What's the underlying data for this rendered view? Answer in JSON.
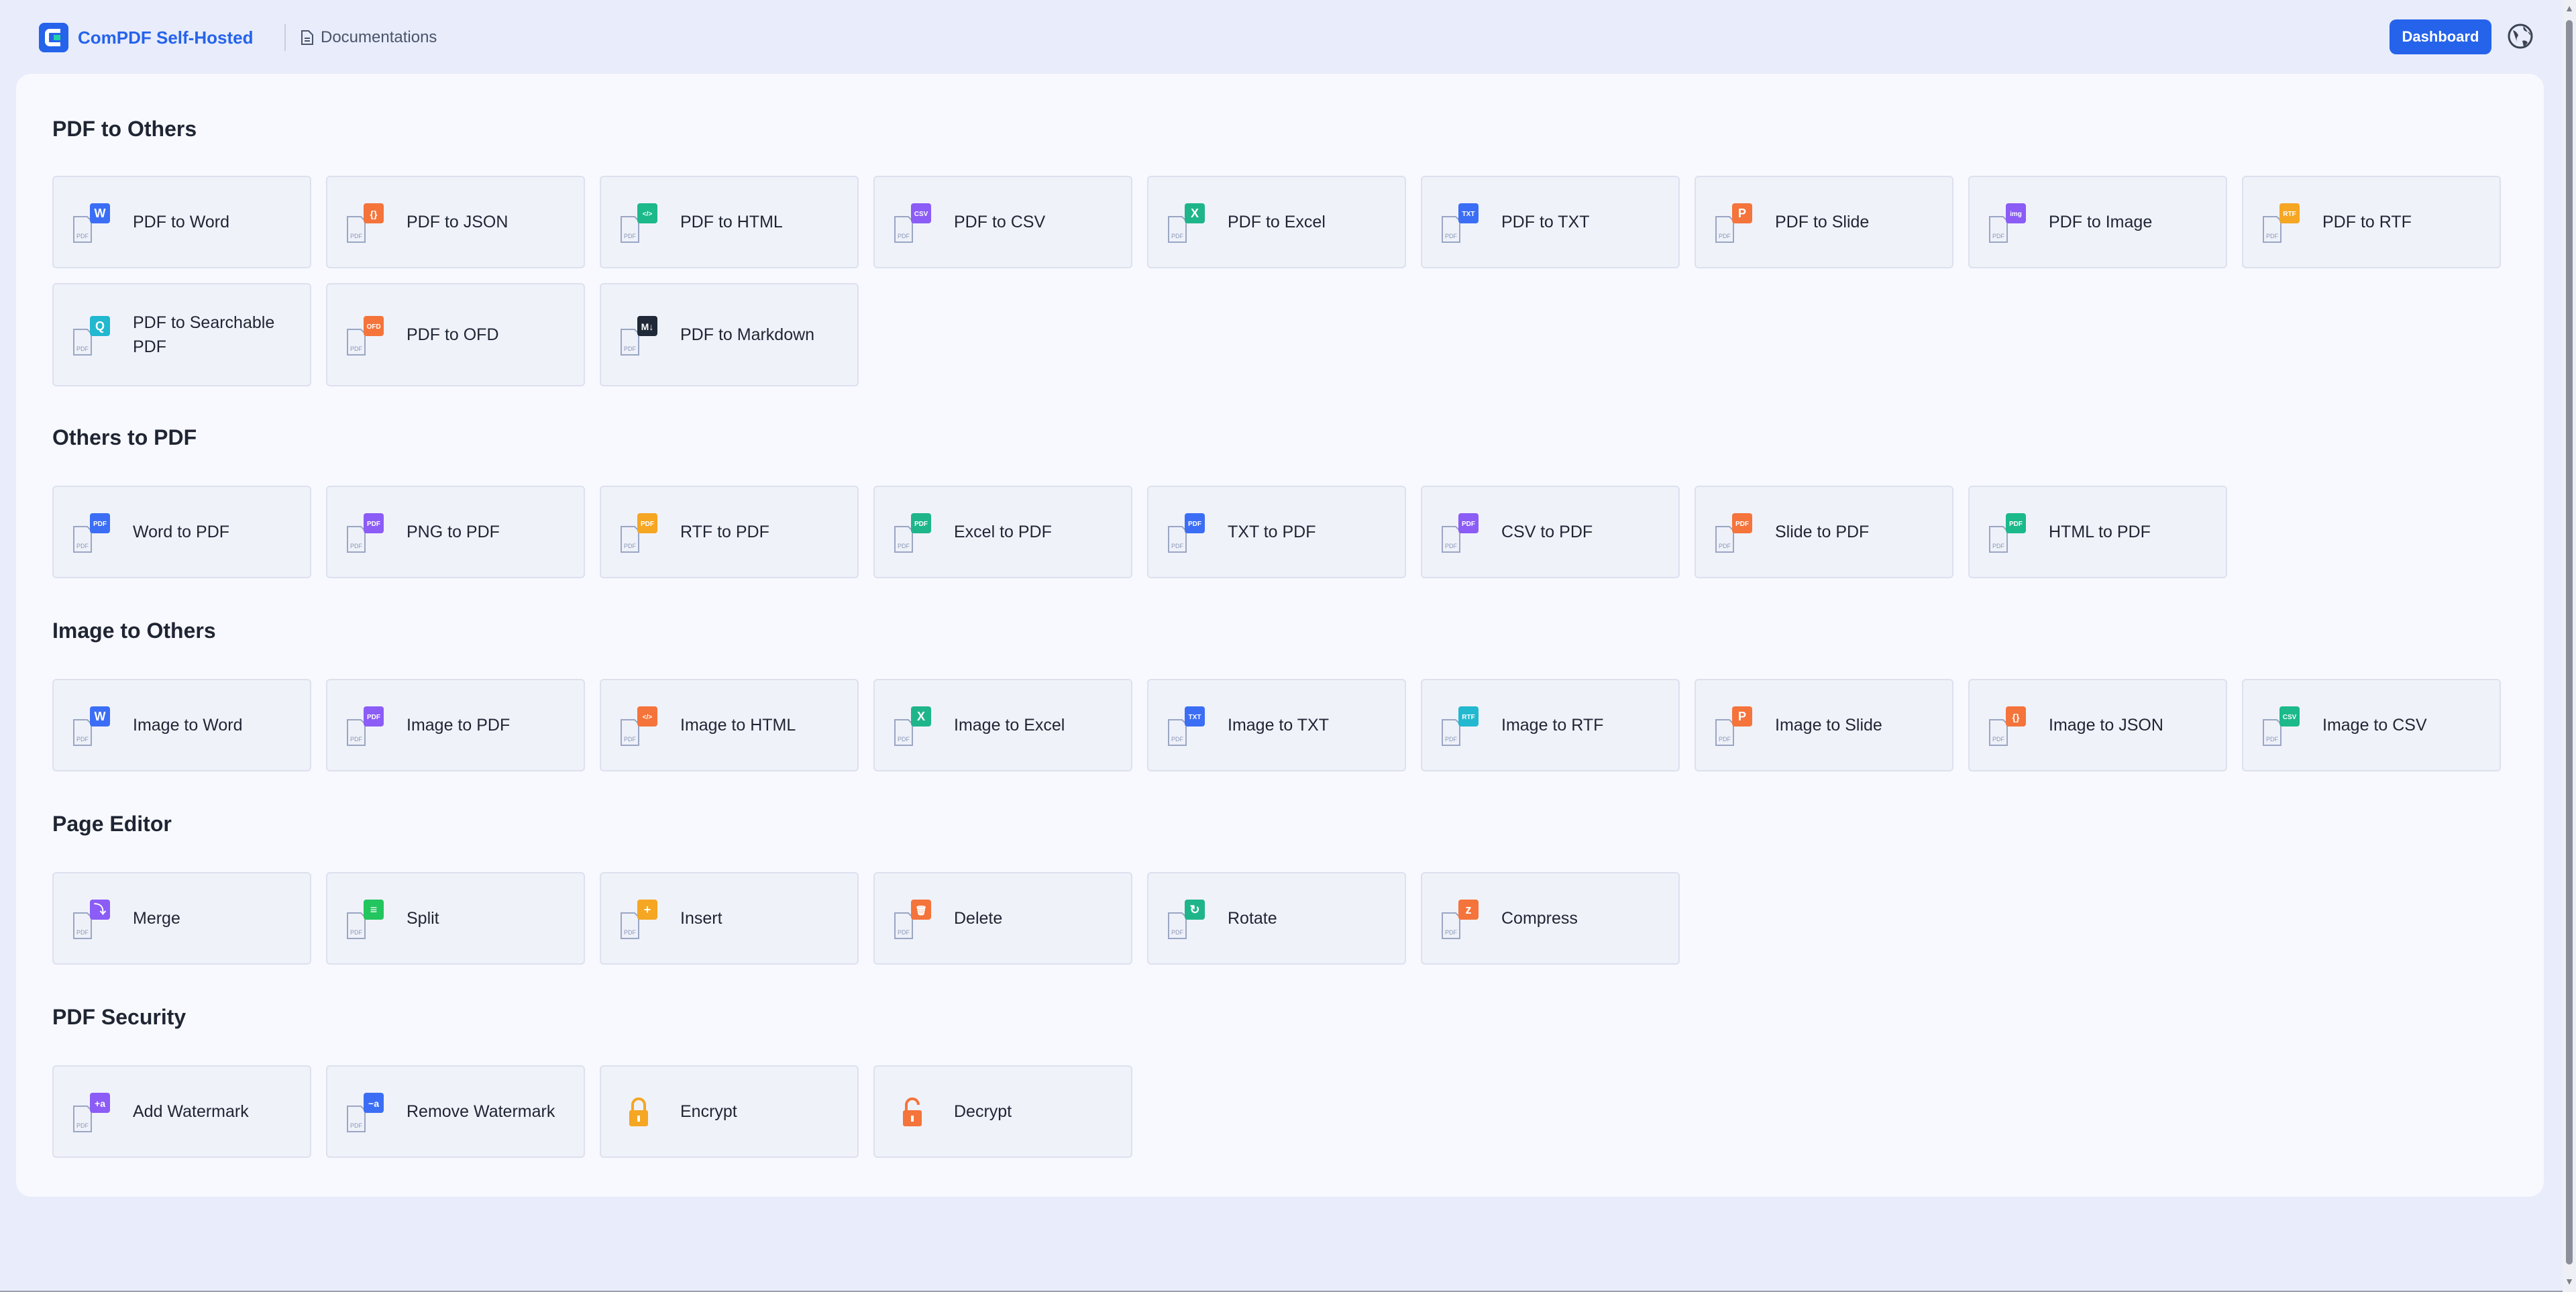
{
  "header": {
    "brand": "ComPDF Self-Hosted",
    "docs_label": "Documentations",
    "dashboard_label": "Dashboard",
    "accent": "#2563eb"
  },
  "sections": [
    {
      "title": "PDF to Others",
      "items": [
        {
          "label": "PDF to Word",
          "badge": "W",
          "color": "#3b6ef5"
        },
        {
          "label": "PDF to JSON",
          "badge": "{}",
          "color": "#f4743b"
        },
        {
          "label": "PDF to HTML",
          "badge": "</>",
          "color": "#1cb98a"
        },
        {
          "label": "PDF to CSV",
          "badge": "CSV",
          "color": "#8b5cf6"
        },
        {
          "label": "PDF to Excel",
          "badge": "X",
          "color": "#1fb58b"
        },
        {
          "label": "PDF to TXT",
          "badge": "TXT",
          "color": "#3b6ef5"
        },
        {
          "label": "PDF to Slide",
          "badge": "P",
          "color": "#f4743b"
        },
        {
          "label": "PDF to Image",
          "badge": "img",
          "color": "#8b5cf6"
        },
        {
          "label": "PDF to RTF",
          "badge": "RTF",
          "color": "#f5a623"
        },
        {
          "label": "PDF to Searchable PDF",
          "badge": "Q",
          "color": "#22b8cf"
        },
        {
          "label": "PDF to OFD",
          "badge": "OFD",
          "color": "#f4743b"
        },
        {
          "label": "PDF to Markdown",
          "badge": "M↓",
          "color": "#1f2937"
        }
      ]
    },
    {
      "title": "Others to PDF",
      "items": [
        {
          "label": "Word to PDF",
          "badge": "PDF",
          "color": "#3b6ef5"
        },
        {
          "label": "PNG to PDF",
          "badge": "PDF",
          "color": "#8b5cf6"
        },
        {
          "label": "RTF to PDF",
          "badge": "PDF",
          "color": "#f5a623"
        },
        {
          "label": "Excel to PDF",
          "badge": "PDF",
          "color": "#1fb58b"
        },
        {
          "label": "TXT to PDF",
          "badge": "PDF",
          "color": "#3b6ef5"
        },
        {
          "label": "CSV to PDF",
          "badge": "PDF",
          "color": "#8b5cf6"
        },
        {
          "label": "Slide to PDF",
          "badge": "PDF",
          "color": "#f4743b"
        },
        {
          "label": "HTML to PDF",
          "badge": "PDF",
          "color": "#1cb98a"
        }
      ]
    },
    {
      "title": "Image to Others",
      "items": [
        {
          "label": "Image to Word",
          "badge": "W",
          "color": "#3b6ef5"
        },
        {
          "label": "Image to PDF",
          "badge": "PDF",
          "color": "#8b5cf6"
        },
        {
          "label": "Image to HTML",
          "badge": "</>",
          "color": "#f4743b"
        },
        {
          "label": "Image to Excel",
          "badge": "X",
          "color": "#1fb58b"
        },
        {
          "label": "Image to TXT",
          "badge": "TXT",
          "color": "#3b6ef5"
        },
        {
          "label": "Image to RTF",
          "badge": "RTF",
          "color": "#22b8cf"
        },
        {
          "label": "Image to Slide",
          "badge": "P",
          "color": "#f4743b"
        },
        {
          "label": "Image to JSON",
          "badge": "{}",
          "color": "#f4743b"
        },
        {
          "label": "Image to CSV",
          "badge": "CSV",
          "color": "#1cb98a"
        }
      ]
    },
    {
      "title": "Page Editor",
      "items": [
        {
          "label": "Merge",
          "badge": "⤵",
          "color": "#8b5cf6"
        },
        {
          "label": "Split",
          "badge": "≡",
          "color": "#22c55e"
        },
        {
          "label": "Insert",
          "badge": "+",
          "color": "#f5a623"
        },
        {
          "label": "Delete",
          "badge": "🗑",
          "color": "#f4743b"
        },
        {
          "label": "Rotate",
          "badge": "↻",
          "color": "#1fb58b"
        },
        {
          "label": "Compress",
          "badge": "z",
          "color": "#f4743b"
        }
      ]
    },
    {
      "title": "PDF Security",
      "items": [
        {
          "label": "Add Watermark",
          "badge": "+a",
          "color": "#8b5cf6"
        },
        {
          "label": "Remove Watermark",
          "badge": "−a",
          "color": "#3b6ef5"
        },
        {
          "label": "Encrypt",
          "badge": "lock",
          "color": "#f5a623"
        },
        {
          "label": "Decrypt",
          "badge": "unlock",
          "color": "#f4743b"
        }
      ]
    }
  ]
}
